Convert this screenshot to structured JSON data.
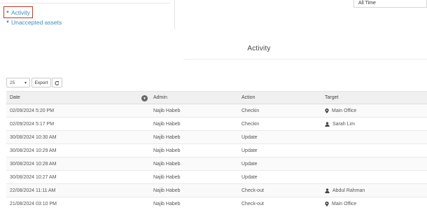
{
  "date_range": {
    "value": "All Time"
  },
  "nav": {
    "activity_label": "Activity",
    "unaccepted_label": "Unaccepted assets"
  },
  "section": {
    "title": "Activity"
  },
  "toolbar": {
    "page_size": "25",
    "export_label": "Export"
  },
  "table": {
    "columns": [
      "Date",
      "Admin",
      "Action",
      "Target"
    ],
    "rows": [
      {
        "date": "02/09/2024 5:20 PM",
        "admin": "Najib Habeb",
        "action": "Checkin",
        "target": "Main Office",
        "target_icon": "location-icon"
      },
      {
        "date": "02/09/2024 5:17 PM",
        "admin": "Najib Habeb",
        "action": "Checkin",
        "target": "Sarah Lim",
        "target_icon": "user-icon"
      },
      {
        "date": "30/08/2024 10:30 AM",
        "admin": "Najib Habeb",
        "action": "Update",
        "target": "",
        "target_icon": ""
      },
      {
        "date": "30/08/2024 10:29 AM",
        "admin": "Najib Habeb",
        "action": "Update",
        "target": "",
        "target_icon": ""
      },
      {
        "date": "30/08/2024 10:28 AM",
        "admin": "Najib Habeb",
        "action": "Update",
        "target": "",
        "target_icon": ""
      },
      {
        "date": "30/08/2024 10:27 AM",
        "admin": "Najib Habeb",
        "action": "Update",
        "target": "",
        "target_icon": ""
      },
      {
        "date": "22/08/2024 11:11 AM",
        "admin": "Najib Habeb",
        "action": "Check-out",
        "target": "Abdul Rahman",
        "target_icon": "user-icon"
      },
      {
        "date": "21/08/2024 03:10 PM",
        "admin": "Najib Habeb",
        "action": "Check-out",
        "target": "Main Office",
        "target_icon": "location-icon"
      }
    ]
  }
}
